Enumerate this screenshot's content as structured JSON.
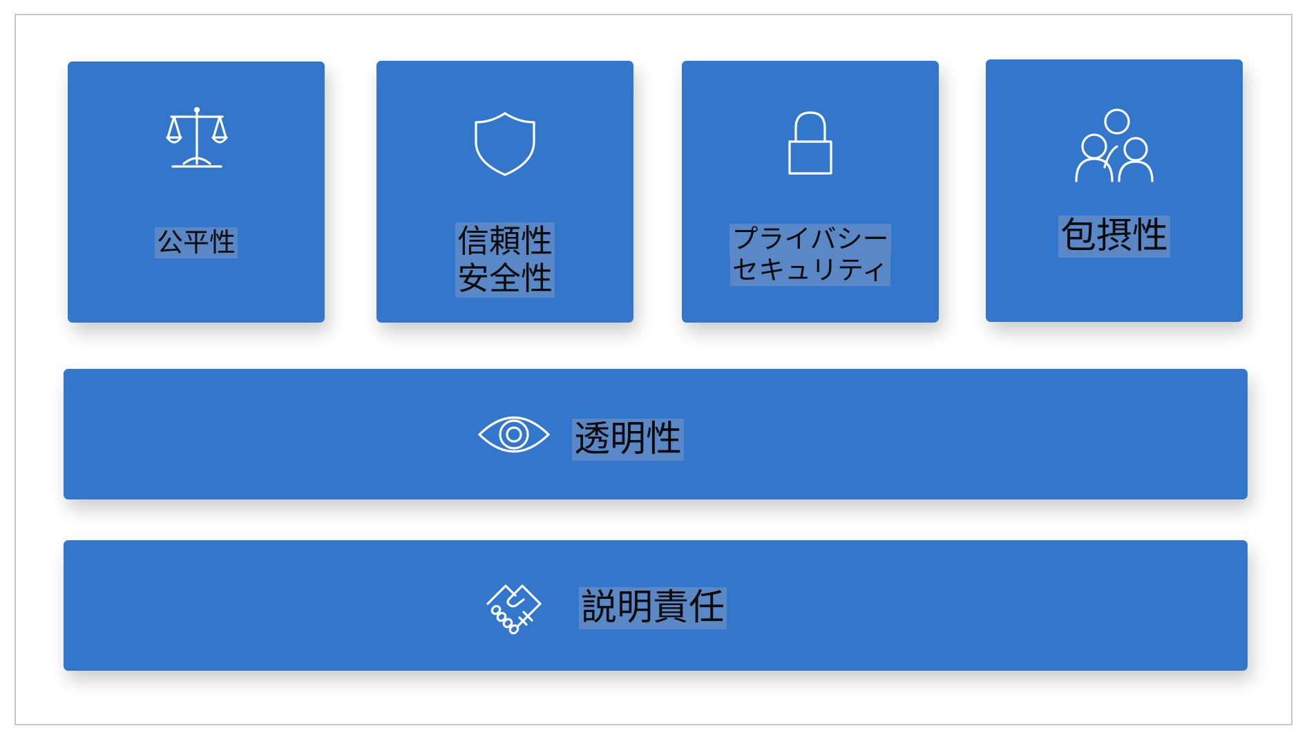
{
  "pillars": [
    {
      "id": "fairness",
      "icon": "scales-icon",
      "lines": [
        "公平性"
      ]
    },
    {
      "id": "reliability-safety",
      "icon": "shield-icon",
      "lines": [
        "信頼性",
        "安全性"
      ]
    },
    {
      "id": "privacy-security",
      "icon": "padlock-icon",
      "lines": [
        "プライバシー",
        "セキュリティ"
      ]
    },
    {
      "id": "inclusiveness",
      "icon": "people-group-icon",
      "lines": [
        "包摂性"
      ]
    }
  ],
  "bars": [
    {
      "id": "transparency",
      "icon": "eye-icon",
      "label": "透明性"
    },
    {
      "id": "accountability",
      "icon": "handshake-icon",
      "label": "説明責任"
    }
  ],
  "colors": {
    "card": "#3277cc",
    "label_highlight": "#5a88c6",
    "icon": "#ffffff",
    "text": "#0b0b0b",
    "frame_border": "#c8c8c8"
  }
}
